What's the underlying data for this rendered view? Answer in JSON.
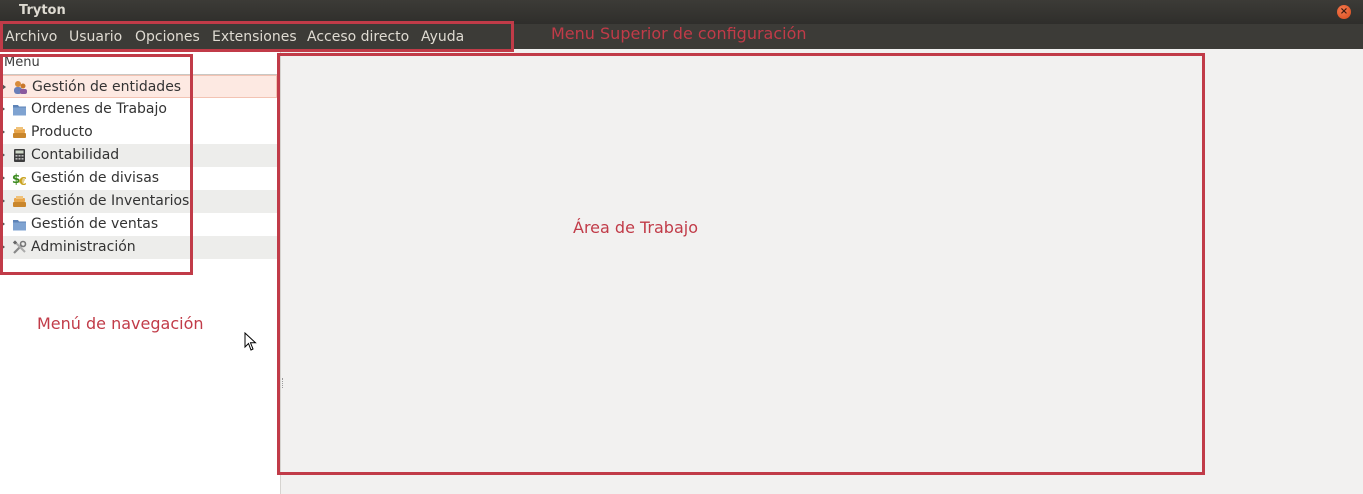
{
  "window": {
    "title": "Tryton"
  },
  "menubar": {
    "items": [
      "Archivo",
      "Usuario",
      "Opciones",
      "Extensiones",
      "Acceso directo",
      "Ayuda"
    ]
  },
  "sidebar": {
    "header": "Menu",
    "items": [
      {
        "label": "Gestión de entidades",
        "icon": "people-icon"
      },
      {
        "label": "Ordenes de Trabajo",
        "icon": "folder-icon"
      },
      {
        "label": "Producto",
        "icon": "box-icon"
      },
      {
        "label": "Contabilidad",
        "icon": "calculator-icon"
      },
      {
        "label": "Gestión de divisas",
        "icon": "currency-icon"
      },
      {
        "label": "Gestión de Inventarios",
        "icon": "box-icon"
      },
      {
        "label": "Gestión de ventas",
        "icon": "folder-icon"
      },
      {
        "label": "Administración",
        "icon": "tools-icon"
      }
    ]
  },
  "annotations": {
    "top_menu": "Menu Superior de configuración",
    "nav_menu": "Menú de navegación",
    "work_area": "Área de Trabajo"
  },
  "colors": {
    "annotation": "#c13b48",
    "titlebar": "#3c3b37",
    "selected_row": "#fde9e2"
  }
}
